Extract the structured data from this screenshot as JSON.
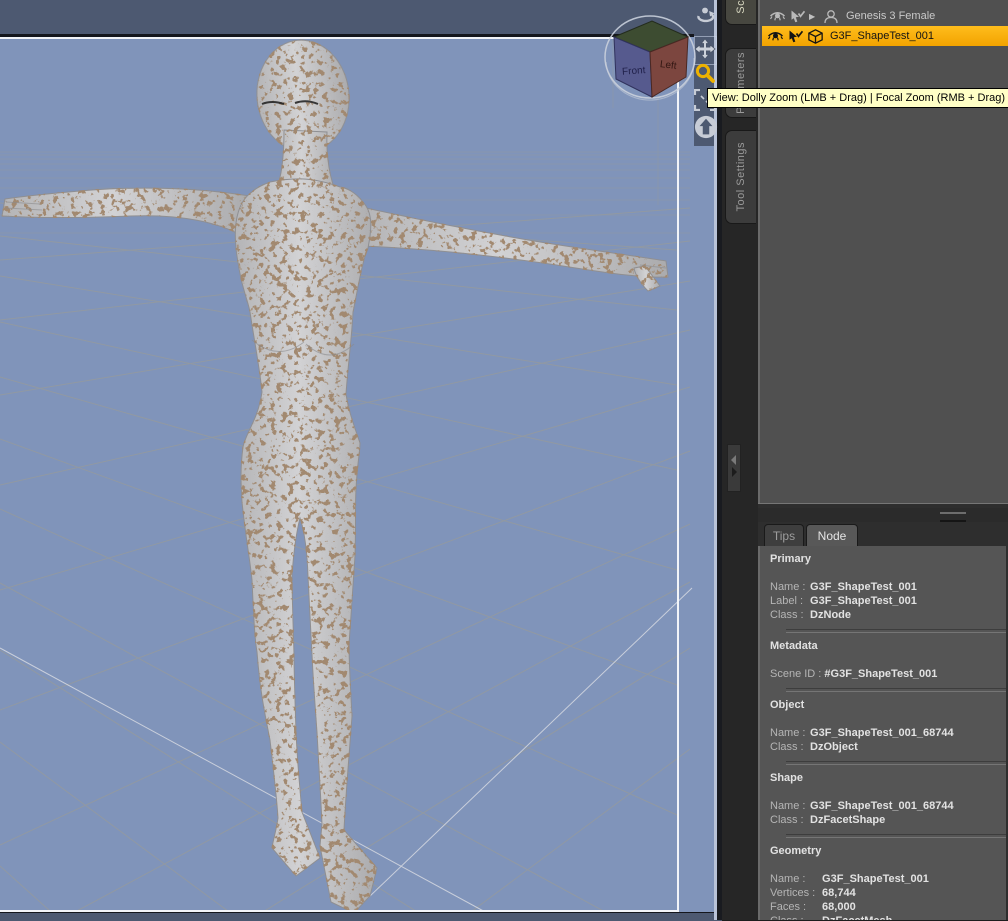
{
  "viewport": {
    "tooltip": "View: Dolly Zoom (LMB + Drag) | Focal Zoom (RMB + Drag)",
    "view_cube": {
      "front_label": "Front",
      "left_label": "Left"
    },
    "nav_icons": [
      "orbit-icon",
      "pan-icon",
      "zoom-icon",
      "frame-icon",
      "aim-icon"
    ],
    "colors": {
      "background": "#8094ba",
      "outside_frame": "#4d5971",
      "grid_line": "#9e9d90",
      "zoom_icon_active": "#eeb200"
    }
  },
  "dock_tabs": [
    {
      "label": "Scene",
      "active": true
    },
    {
      "label": "Parameters",
      "active": false
    },
    {
      "label": "Tool Settings",
      "active": false
    }
  ],
  "scene_panel": {
    "items": [
      {
        "label": "Genesis 3 Female",
        "selected": false,
        "icons": [
          "eye-icon",
          "pointer-check-icon",
          "expand-icon",
          "group-icon"
        ]
      },
      {
        "label": "G3F_ShapeTest_001",
        "selected": true,
        "icons": [
          "eye-icon",
          "pointer-check-icon",
          "cube-icon"
        ]
      }
    ],
    "selection_color": "#F6AC00"
  },
  "info_panel": {
    "tabs": [
      {
        "label": "Tips",
        "active": false
      },
      {
        "label": "Node",
        "active": true
      }
    ],
    "sections": [
      {
        "title": "Primary",
        "wide_labels": false,
        "rows": [
          {
            "label": "Name :",
            "value": "G3F_ShapeTest_001"
          },
          {
            "label": "Label :",
            "value": "G3F_ShapeTest_001"
          },
          {
            "label": "Class :",
            "value": "DzNode"
          }
        ]
      },
      {
        "title": "Metadata",
        "wide_labels": false,
        "rows": [
          {
            "label": "Scene ID :",
            "value": "#G3F_ShapeTest_001"
          }
        ]
      },
      {
        "title": "Object",
        "wide_labels": false,
        "rows": [
          {
            "label": "Name :",
            "value": "G3F_ShapeTest_001_68744"
          },
          {
            "label": "Class :",
            "value": "DzObject"
          }
        ]
      },
      {
        "title": "Shape",
        "wide_labels": false,
        "rows": [
          {
            "label": "Name :",
            "value": "G3F_ShapeTest_001_68744"
          },
          {
            "label": "Class :",
            "value": "DzFacetShape"
          }
        ]
      },
      {
        "title": "Geometry",
        "wide_labels": true,
        "rows": [
          {
            "label": "Name :",
            "value": "G3F_ShapeTest_001"
          },
          {
            "label": "Vertices :",
            "value": "68,744"
          },
          {
            "label": "Faces :",
            "value": "68,000"
          },
          {
            "label": "Class :",
            "value": "DzFacetMesh"
          }
        ]
      }
    ]
  }
}
